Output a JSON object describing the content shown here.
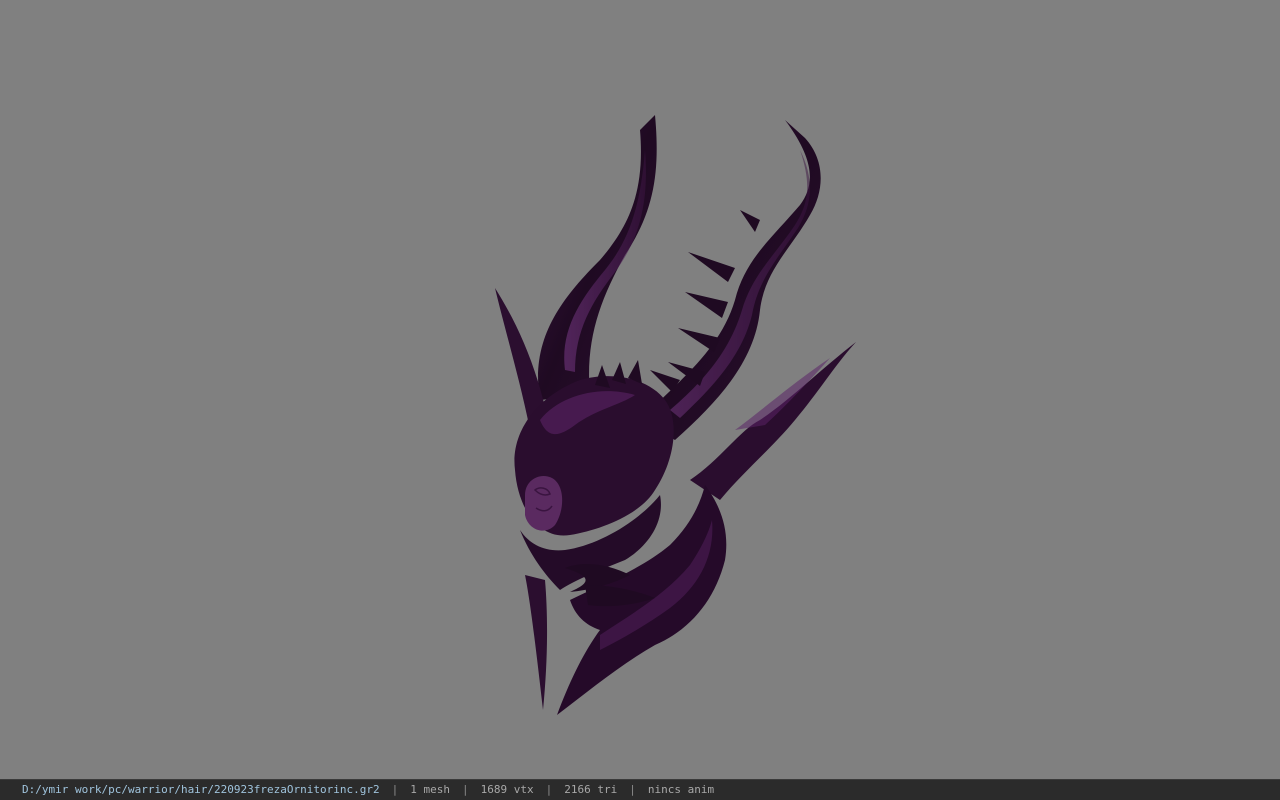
{
  "viewport": {
    "background_color": "#808080",
    "model_name": "helmet-model",
    "model_color": "#2a0f2d",
    "highlight_color": "#6a2a78"
  },
  "statusbar": {
    "file_path": "D:/ymir work/pc/warrior/hair/220923frezaOrnitorinc.gr2",
    "separator": "|",
    "mesh_count": "1 mesh",
    "vertex_count": "1689 vtx",
    "triangle_count": "2166 tri",
    "animation_status": "nincs anim"
  }
}
